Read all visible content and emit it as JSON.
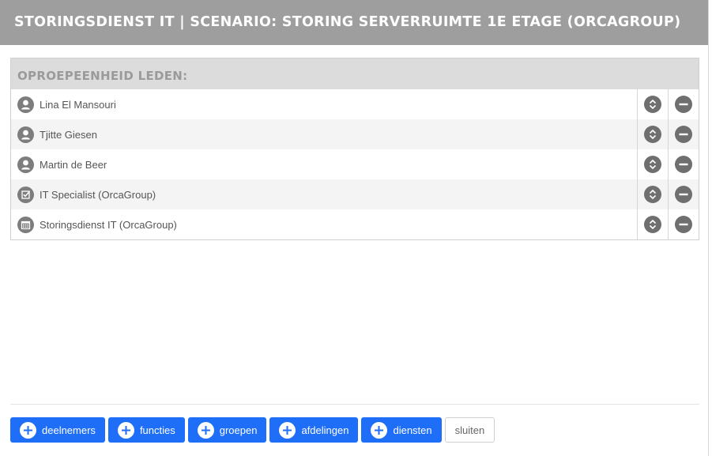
{
  "modal": {
    "title": "STORINGSDIENST IT | SCENARIO: STORING SERVERRUIMTE 1E ETAGE (ORCAGROUP)"
  },
  "panel": {
    "header": "OPROEPEENHEID LEDEN:",
    "rows": [
      {
        "name": "Lina El Mansouri",
        "icon": "person-icon"
      },
      {
        "name": "Tjitte Giesen",
        "icon": "person-icon"
      },
      {
        "name": "Martin de Beer",
        "icon": "person-icon"
      },
      {
        "name": "IT Specialist (OrcaGroup)",
        "icon": "function-check-icon"
      },
      {
        "name": "Storingsdienst IT (OrcaGroup)",
        "icon": "calendar-icon"
      }
    ]
  },
  "footer": {
    "buttons": [
      "deelnemers",
      "functies",
      "groepen",
      "afdelingen",
      "diensten"
    ],
    "close_label": "sluiten"
  },
  "colors": {
    "titlebar": "#9e9e9e",
    "accent": "#1e6ef7",
    "icon_grey": "#6f6f6f"
  }
}
